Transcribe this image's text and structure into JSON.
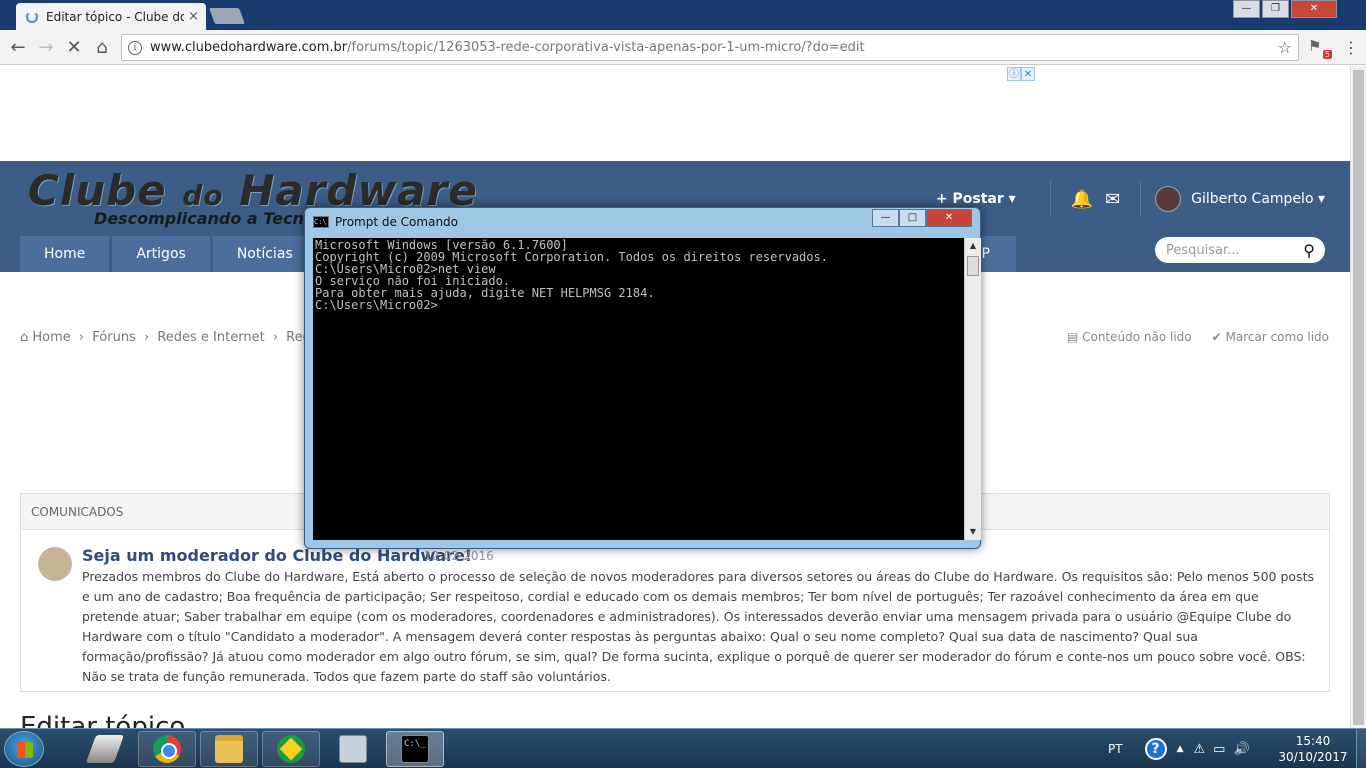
{
  "browser": {
    "tab_title": "Editar tópico - Clube do H",
    "tab_close": "×",
    "url_host": "www.clubedohardware.com.br",
    "url_path": "/forums/topic/1263053-rede-corporativa-vista-apenas-por-1-um-micro/?do=edit",
    "info_glyph": "i",
    "star_glyph": "☆",
    "back_glyph": "←",
    "forward_glyph": "→",
    "reload_glyph": "✕",
    "home_glyph": "⌂",
    "menu_glyph": "⋮",
    "extension_badge": "5",
    "window_controls": {
      "minimize": "—",
      "restore": "❐",
      "close": "✕"
    }
  },
  "ad": {
    "info_glyph": "ⓘ",
    "close_glyph": "✕"
  },
  "site": {
    "logo": {
      "word1": "Clube ",
      "word2": "do",
      "word3": " Hardware"
    },
    "tagline": "Descomplicando a Tecn",
    "post_button": "+ Postar ▾",
    "bell_glyph": "🔔",
    "mail_glyph": "✉",
    "username": "Gilberto Campelo ▾",
    "nav": [
      "Home",
      "Artigos",
      "Notícias"
    ],
    "nav_partial": "P",
    "search_placeholder": "Pesquisar...",
    "search_glyph": "⚲"
  },
  "breadcrumb": {
    "items": [
      "⌂ Home",
      "›",
      "Fóruns",
      "›",
      "Redes e Internet",
      "›",
      "Redes"
    ],
    "unread": "▤ Conteúdo não lido",
    "mark_read": "✔ Marcar como lido"
  },
  "announcement": {
    "header": "COMUNICADOS",
    "title": "Seja um moderador do Clube do Hardware!",
    "date": "12-02-2016",
    "body": "Prezados membros do Clube do Hardware, Está aberto o processo de seleção de novos moderadores para diversos setores ou áreas do Clube do Hardware. Os requisitos são:   Pelo menos 500 posts e um ano de cadastro; Boa frequência de participação; Ser respeitoso, cordial e educado com os demais membros; Ter bom nível de português; Ter razoável conhecimento da área em que pretende atuar; Saber trabalhar em equipe (com os moderadores, coordenadores e administradores).   Os interessados deverão enviar uma mensagem privada para o usuário @Equipe Clube do Hardware com o título \"Candidato a moderador\". A mensagem deverá conter respostas às perguntas abaixo:   Qual o seu nome completo? Qual sua data de nascimento? Qual sua formação/profissão? Já atuou como moderador em algo outro fórum, se sim, qual? De forma sucinta, explique o porquê de querer ser moderador do fórum e conte-nos um pouco sobre você.   OBS: Não se trata de função remunerada. Todos que fazem parte do staff são voluntários."
  },
  "page_heading": "Editar tópico",
  "cmd": {
    "title": "Prompt de Comando",
    "icon_text": "C:\\",
    "lines": [
      "Microsoft Windows [versão 6.1.7600]",
      "Copyright (c) 2009 Microsoft Corporation. Todos os direitos reservados.",
      "",
      "C:\\Users\\Micro02>net view",
      "O serviço não foi iniciado.",
      "",
      "Para obter mais ajuda, digite NET HELPMSG 2184.",
      "",
      "",
      "C:\\Users\\Micro02>"
    ],
    "scroll_up": "▲",
    "scroll_down": "▼",
    "controls": {
      "minimize": "—",
      "restore": "□",
      "close": "✕"
    }
  },
  "taskbar": {
    "cmd_icon_text": "C:\\_",
    "language": "PT",
    "help_glyph": "?",
    "tray_arrow": "▲",
    "tray_icons": [
      "⚠",
      "▭",
      "🔊"
    ],
    "time": "15:40",
    "date": "30/10/2017"
  }
}
